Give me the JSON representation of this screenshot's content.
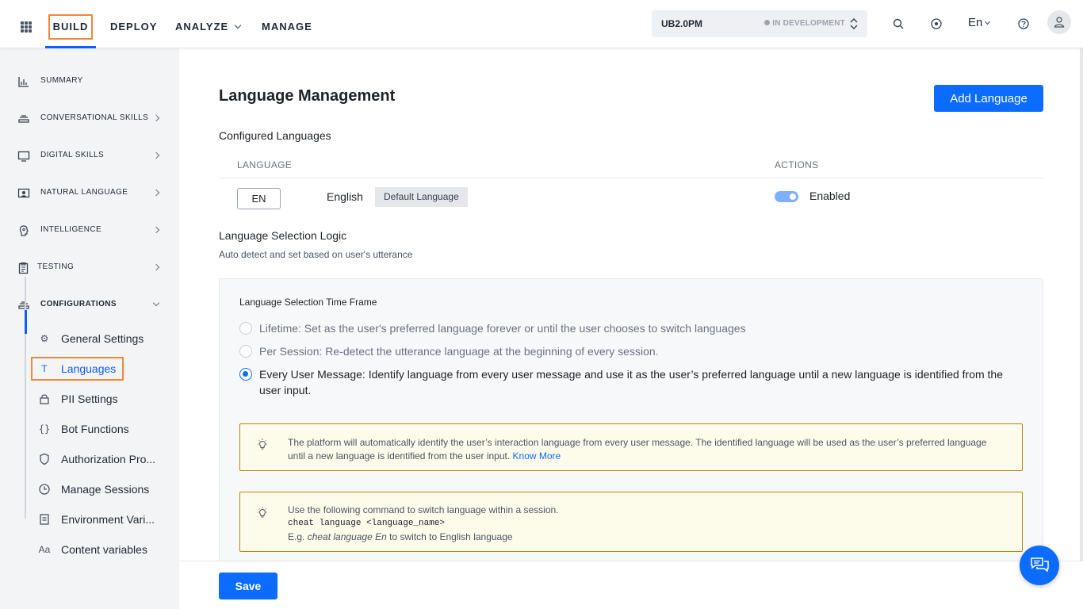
{
  "topnav": {
    "items": [
      "BUILD",
      "DEPLOY",
      "ANALYZE",
      "MANAGE"
    ],
    "active": "BUILD"
  },
  "env": {
    "name": "UB2.0PM",
    "status": "IN DEVELOPMENT"
  },
  "toolbar": {
    "lang": "En"
  },
  "sidebar": {
    "items": [
      {
        "label": "SUMMARY",
        "icon": "bar-chart-icon"
      },
      {
        "label": "CONVERSATIONAL SKILLS",
        "icon": "layers-icon"
      },
      {
        "label": "DIGITAL SKILLS",
        "icon": "monitor-icon"
      },
      {
        "label": "NATURAL LANGUAGE",
        "icon": "nlp-icon"
      },
      {
        "label": "INTELLIGENCE",
        "icon": "brain-icon"
      },
      {
        "label": "TESTING",
        "icon": "clipboard-icon"
      },
      {
        "label": "CONFIGURATIONS",
        "icon": "layers-icon"
      }
    ],
    "sub_items": [
      {
        "label": "General Settings",
        "icon": "gear-icon"
      },
      {
        "label": "Languages",
        "icon": "text-icon"
      },
      {
        "label": "PII Settings",
        "icon": "lock-icon"
      },
      {
        "label": "Bot Functions",
        "icon": "braces-icon"
      },
      {
        "label": "Authorization Pro...",
        "icon": "shield-icon"
      },
      {
        "label": "Manage Sessions",
        "icon": "clock-icon"
      },
      {
        "label": "Environment Vari...",
        "icon": "document-icon"
      },
      {
        "label": "Content variables",
        "icon": "font-icon"
      }
    ]
  },
  "main": {
    "title": "Language Management",
    "add_button": "Add Language",
    "configured_title": "Configured Languages",
    "columns": [
      "LANGUAGE",
      "ACTIONS"
    ],
    "languages": [
      {
        "code": "EN",
        "name": "English",
        "badge": "Default Language",
        "status": "Enabled",
        "enabled": true
      }
    ],
    "logic_title": "Language Selection Logic",
    "logic_subtitle": "Auto detect and set based on user's utterance",
    "panel": {
      "title": "Language Selection Time Frame",
      "options": [
        "Lifetime: Set as the user's preferred language forever or until the user chooses to switch languages",
        "Per Session: Re-detect the utterance language at the beginning of every session.",
        "Every User Message: Identify language from every user message and use it as the user’s preferred language until a new language is identified from the user input."
      ],
      "selected_index": 2,
      "info1": "The platform will automatically identify the user’s interaction language from every user message. The identified language will be used as the user’s preferred language until a new language is identified from the user input.",
      "info1_link": "Know More",
      "info2_line1": "Use the following command to switch language within a session.",
      "info2_command": "cheat language <language_name>",
      "info2_eg_prefix": "E.g.",
      "info2_eg_italic": "cheat language En",
      "info2_eg_suffix": "to switch to English language"
    }
  },
  "footer": {
    "save": "Save"
  },
  "colors": {
    "primary": "#0b6cff",
    "highlight": "#f0873a"
  }
}
